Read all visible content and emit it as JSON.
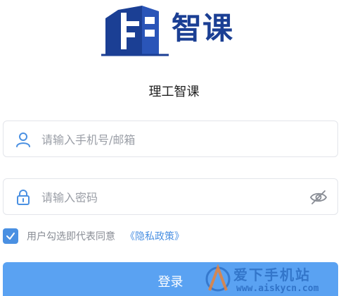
{
  "logo": {
    "text": "智课"
  },
  "app": {
    "title": "理工智课"
  },
  "phone_field": {
    "placeholder": "请输入手机号/邮箱",
    "value": ""
  },
  "password_field": {
    "placeholder": "请输入密码",
    "value": ""
  },
  "agreement": {
    "checked": true,
    "text": "用户勾选即代表同意",
    "policy_link": "《隐私政策》"
  },
  "login_button": {
    "label": "登录"
  },
  "watermark": {
    "title": "爱下手机站",
    "url": "www.aiskycn.com"
  },
  "colors": {
    "brand": "#1b3f94",
    "accent": "#4a90e2",
    "button": "#5aa2f2",
    "placeholder": "#9a9ea6"
  }
}
